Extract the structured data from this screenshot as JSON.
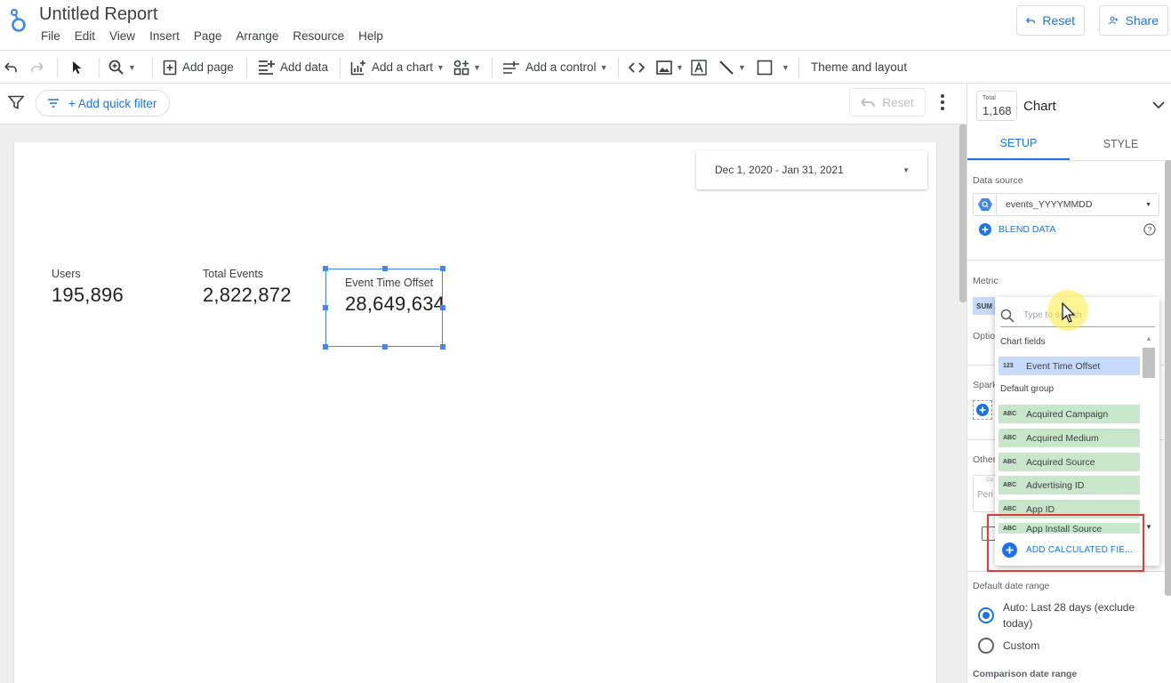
{
  "app": {
    "title": "Untitled Report",
    "menu": [
      "File",
      "Edit",
      "View",
      "Insert",
      "Page",
      "Arrange",
      "Resource",
      "Help"
    ],
    "reset_label": "Reset",
    "share_label": "Share"
  },
  "toolbar": {
    "add_page": "Add page",
    "add_data": "Add data",
    "add_chart": "Add a chart",
    "add_control": "Add a control",
    "theme_layout": "Theme and layout"
  },
  "filterbar": {
    "quick_filter": "+ Add quick filter",
    "reset": "Reset"
  },
  "canvas": {
    "date_range": "Dec 1, 2020 - Jan 31, 2021",
    "scorecards": [
      {
        "label": "Users",
        "value": "195,896"
      },
      {
        "label": "Total Events",
        "value": "2,822,872"
      },
      {
        "label": "Event Time Offset",
        "value": "28,649,634"
      }
    ]
  },
  "panel": {
    "total_label": "Total",
    "total_value": "1,168",
    "chart_type": "Chart",
    "tabs": [
      "SETUP",
      "STYLE"
    ],
    "data_source_label": "Data source",
    "data_source_value": "events_YYYYMMDD",
    "blend_data": "BLEND DATA",
    "metric_label": "Metric",
    "sum_chip": "SUM",
    "optional_label": "Optio",
    "sparkline_label": "Spark",
    "other_label": "Other",
    "comparison_small": "Co",
    "period_placeholder": "Peri",
    "default_date_range": "Default date range",
    "auto_option_bold": "Auto:",
    "auto_option_rest": "Last 28 days (exclude",
    "auto_option_line2": "today)",
    "custom_option": "Custom",
    "comparison_date_range": "Comparison date range"
  },
  "dropdown": {
    "search_placeholder": "Type to search",
    "chart_fields_header": "Chart fields",
    "chart_fields": [
      {
        "type": "123",
        "name": "Event Time Offset"
      }
    ],
    "default_group_header": "Default group",
    "default_group": [
      {
        "type": "ABC",
        "name": "Acquired Campaign"
      },
      {
        "type": "ABC",
        "name": "Acquired Medium"
      },
      {
        "type": "ABC",
        "name": "Acquired Source"
      },
      {
        "type": "ABC",
        "name": "Advertising ID"
      },
      {
        "type": "ABC",
        "name": "App ID"
      },
      {
        "type": "ABC",
        "name": "App Install Source"
      }
    ],
    "add_calculated_field": "ADD CALCULATED FIE..."
  },
  "colors": {
    "accent": "#1a73e8",
    "field_numeric_bg": "#c6dafc",
    "field_dimension_bg": "#c8e6c9",
    "highlight_box": "#e53935"
  }
}
